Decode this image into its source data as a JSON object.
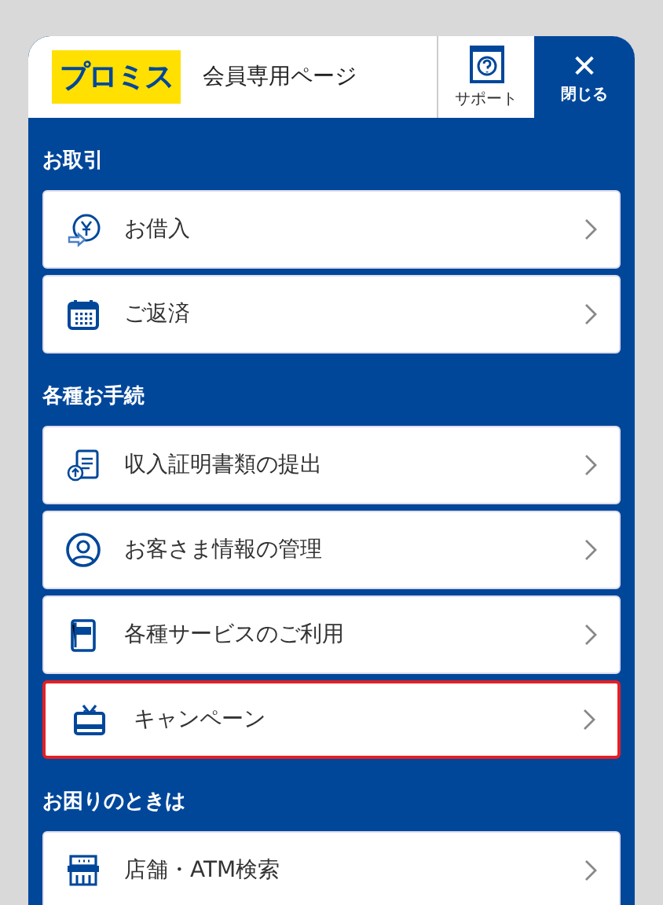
{
  "header": {
    "logo": "プロミス",
    "title": "会員専用ページ",
    "support": "サポート",
    "close": {
      "icon": "✕",
      "label": "閉じる"
    }
  },
  "sections": [
    {
      "heading": "お取引",
      "items": [
        {
          "label": "お借入",
          "kind": "yen",
          "highlighted": false
        },
        {
          "label": "ご返済",
          "kind": "calendar",
          "highlighted": false
        }
      ]
    },
    {
      "heading": "各種お手続",
      "items": [
        {
          "label": "収入証明書類の提出",
          "kind": "document",
          "highlighted": false
        },
        {
          "label": "お客さま情報の管理",
          "kind": "person",
          "highlighted": false
        },
        {
          "label": "各種サービスのご利用",
          "kind": "book",
          "highlighted": false
        },
        {
          "label": "キャンペーン",
          "kind": "gift",
          "highlighted": true
        }
      ]
    },
    {
      "heading": "お困りのときは",
      "items": [
        {
          "label": "店舗・ATM検索",
          "kind": "store",
          "highlighted": false
        }
      ]
    }
  ]
}
